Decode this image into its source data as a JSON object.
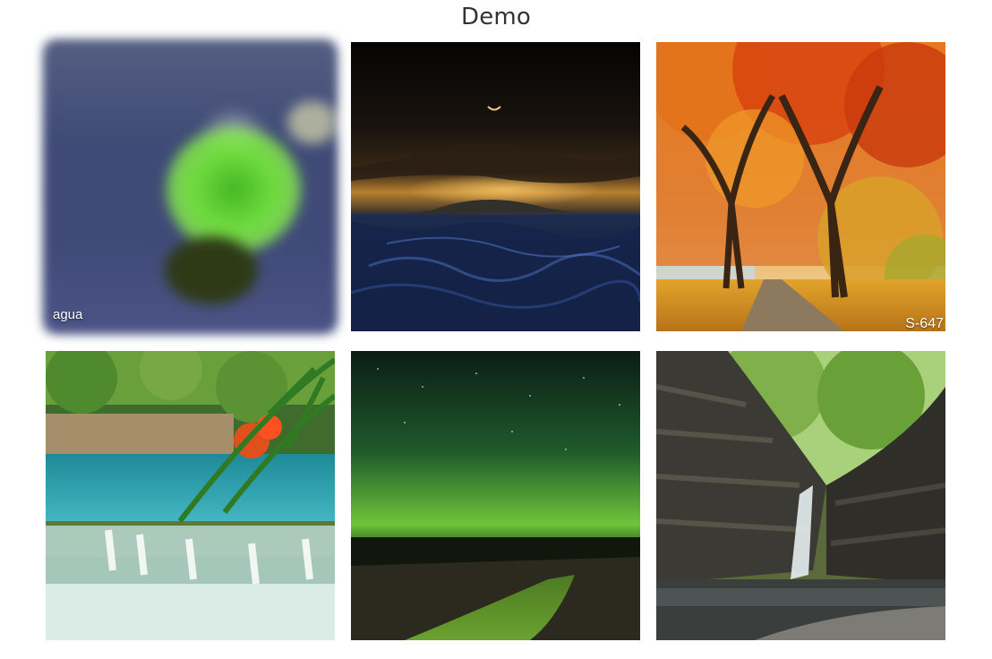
{
  "page": {
    "title": "Demo"
  },
  "gallery": {
    "tiles": [
      {
        "caption": "agua",
        "image": "water-lily-blurred"
      },
      {
        "caption": "",
        "image": "stormy-sea-crescent-moon"
      },
      {
        "caption": "S-647",
        "image": "autumn-trees-path"
      },
      {
        "caption": "",
        "image": "turquoise-waterfall"
      },
      {
        "caption": "",
        "image": "aurora-river-night"
      },
      {
        "caption": "",
        "image": "gorge-waterfall-forest"
      }
    ]
  }
}
